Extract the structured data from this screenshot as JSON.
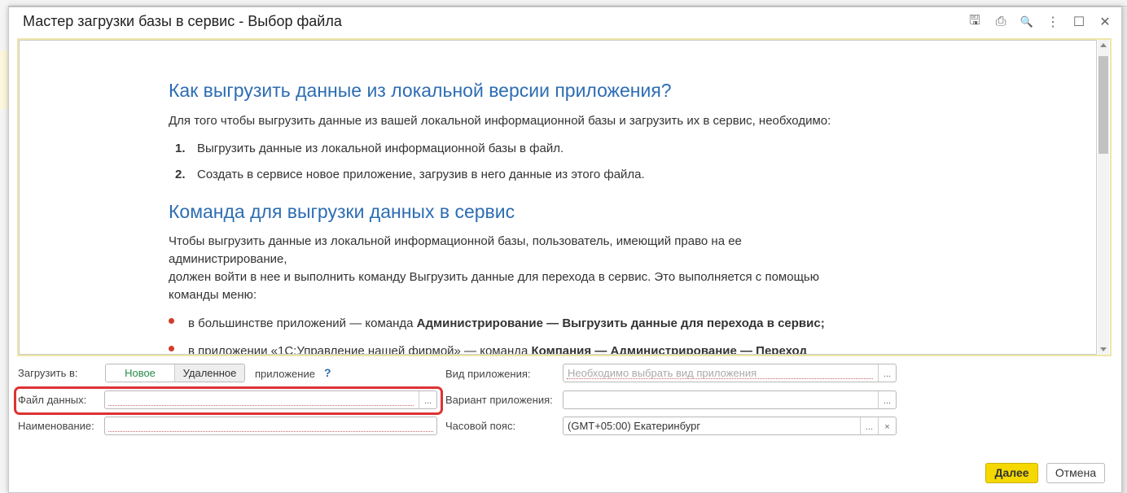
{
  "window": {
    "title": "Мастер загрузки базы в сервис - Выбор файла",
    "tools": [
      {
        "icon": "save-icon",
        "glyph": "🖫"
      },
      {
        "icon": "print-icon",
        "glyph": "⎙"
      },
      {
        "icon": "preview-icon",
        "glyph": "🔍"
      },
      {
        "icon": "more-icon",
        "glyph": "⋮"
      },
      {
        "icon": "maximize-icon",
        "glyph": "☐"
      },
      {
        "icon": "close-icon",
        "glyph": "✕"
      }
    ]
  },
  "content": {
    "h1": "Как выгрузить данные из локальной версии приложения?",
    "p1": "Для того чтобы выгрузить данные из вашей локальной информационной базы и загрузить их в сервис, необходимо:",
    "steps": [
      {
        "n": "1.",
        "t": "Выгрузить данные из локальной информационной базы в файл."
      },
      {
        "n": "2.",
        "t": "Создать в сервисе новое приложение, загрузив в него данные из этого файла."
      }
    ],
    "h2": "Команда для выгрузки данных в сервис",
    "p2a": "Чтобы выгрузить данные из локальной информационной базы, пользователь, имеющий право на ее",
    "p2b": "администрирование,",
    "p2c": "должен войти в нее и выполнить команду Выгрузить данные для перехода в сервис. Это выполняется с помощью",
    "p2d": "команды меню:",
    "b1": {
      "t": "в большинстве приложений — команда ",
      "b": "Администрирование — Выгрузить данные для перехода в сервис;"
    },
    "b2": {
      "t": "в приложении «1С:Управление нашей фирмой» — команда ",
      "b": "Компания — Администрирование — Переход"
    }
  },
  "form": {
    "load_to_label": "Загрузить в:",
    "opt_new": "Новое",
    "opt_remote": "Удаленное",
    "app_word": "приложение",
    "help": "?",
    "file_label": "Файл данных:",
    "file_value": "",
    "name_label": "Наименование:",
    "name_value": "",
    "kind_label": "Вид приложения:",
    "kind_placeholder": "Необходимо выбрать вид приложения",
    "variant_label": "Вариант приложения:",
    "variant_value": "",
    "tz_label": "Часовой пояс:",
    "tz_value": "(GMT+05:00) Екатеринбург",
    "ellipsis": "...",
    "clear": "×"
  },
  "buttons": {
    "next": "Далее",
    "cancel": "Отмена"
  },
  "colors": {
    "heading": "#2d6db3",
    "highlight": "#dd3333",
    "primary": "#f5d800",
    "selected_option": "#2a8a4a"
  }
}
